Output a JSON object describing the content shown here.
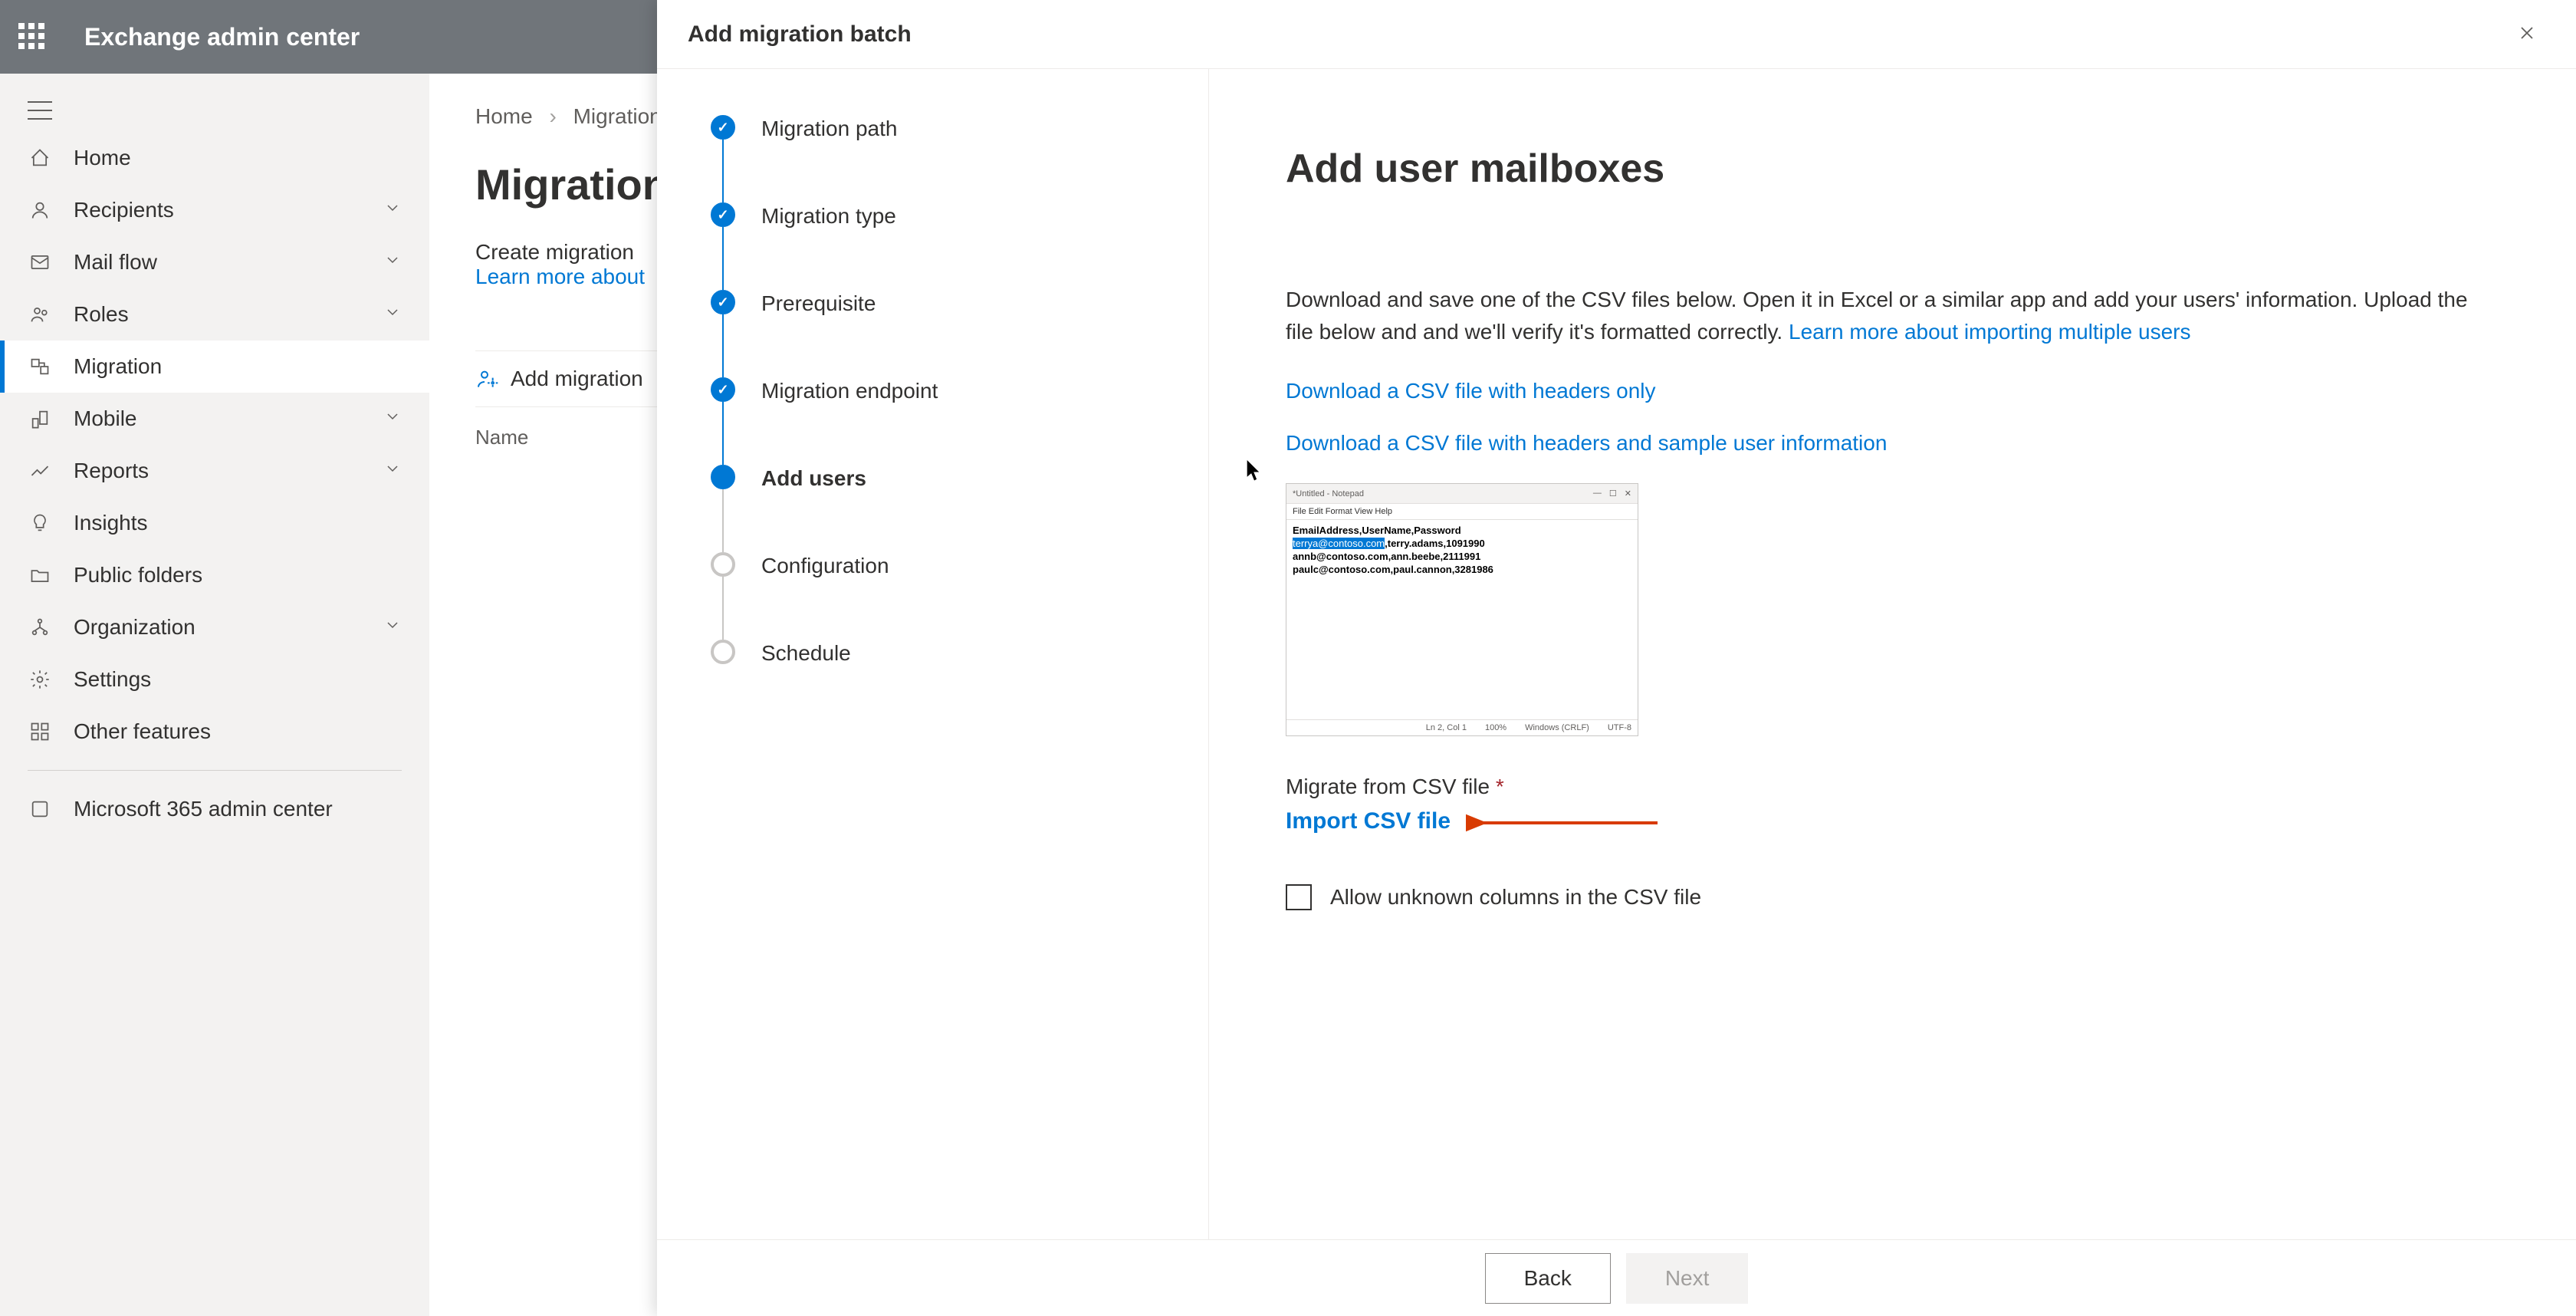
{
  "header": {
    "title": "Exchange admin center"
  },
  "sidebar": {
    "items": [
      {
        "label": "Home",
        "icon": "home"
      },
      {
        "label": "Recipients",
        "icon": "person",
        "chevron": true
      },
      {
        "label": "Mail flow",
        "icon": "mail",
        "chevron": true
      },
      {
        "label": "Roles",
        "icon": "roles",
        "chevron": true
      },
      {
        "label": "Migration",
        "icon": "migration",
        "active": true
      },
      {
        "label": "Mobile",
        "icon": "mobile",
        "chevron": true
      },
      {
        "label": "Reports",
        "icon": "reports",
        "chevron": true
      },
      {
        "label": "Insights",
        "icon": "insights"
      },
      {
        "label": "Public folders",
        "icon": "folders"
      },
      {
        "label": "Organization",
        "icon": "org",
        "chevron": true
      },
      {
        "label": "Settings",
        "icon": "settings"
      },
      {
        "label": "Other features",
        "icon": "grid"
      }
    ],
    "footer_item": {
      "label": "Microsoft 365 admin center",
      "icon": "m365"
    }
  },
  "breadcrumb": {
    "home": "Home",
    "current": "Migration"
  },
  "page": {
    "title": "Migration",
    "desc_line1": "Create migration",
    "learn_more": "Learn more about",
    "toolbar_action": "Add migration",
    "col_name": "Name"
  },
  "panel": {
    "title": "Add migration batch",
    "steps": [
      {
        "label": "Migration path",
        "state": "done"
      },
      {
        "label": "Migration type",
        "state": "done"
      },
      {
        "label": "Prerequisite",
        "state": "done"
      },
      {
        "label": "Migration endpoint",
        "state": "done"
      },
      {
        "label": "Add users",
        "state": "current"
      },
      {
        "label": "Configuration",
        "state": "pending"
      },
      {
        "label": "Schedule",
        "state": "pending"
      }
    ],
    "content": {
      "title": "Add user mailboxes",
      "description": "Download and save one of the CSV files below. Open it in Excel or a similar app and add your users' information. Upload the file below and and we'll verify it's formatted correctly.",
      "learn_more_link": "Learn more about importing multiple users",
      "download_headers_link": "Download a CSV file with headers only",
      "download_sample_link": "Download a CSV file with headers and sample user information",
      "csv_preview": {
        "window_title": "*Untitled - Notepad",
        "menu": "File   Edit   Format   View   Help",
        "header_row": "EmailAddress,UserName,Password",
        "row1_highlight": "terrya@contoso.com",
        "row1_rest": ",terry.adams,1091990",
        "row2": "annb@contoso.com,ann.beebe,2111991",
        "row3": "paulc@contoso.com,paul.cannon,3281986",
        "status_ln": "Ln 2, Col 1",
        "status_zoom": "100%",
        "status_eol": "Windows (CRLF)",
        "status_enc": "UTF-8"
      },
      "csv_field_label": "Migrate from CSV file",
      "import_link": "Import CSV file",
      "checkbox_label": "Allow unknown columns in the CSV file"
    },
    "footer": {
      "back": "Back",
      "next": "Next"
    }
  }
}
